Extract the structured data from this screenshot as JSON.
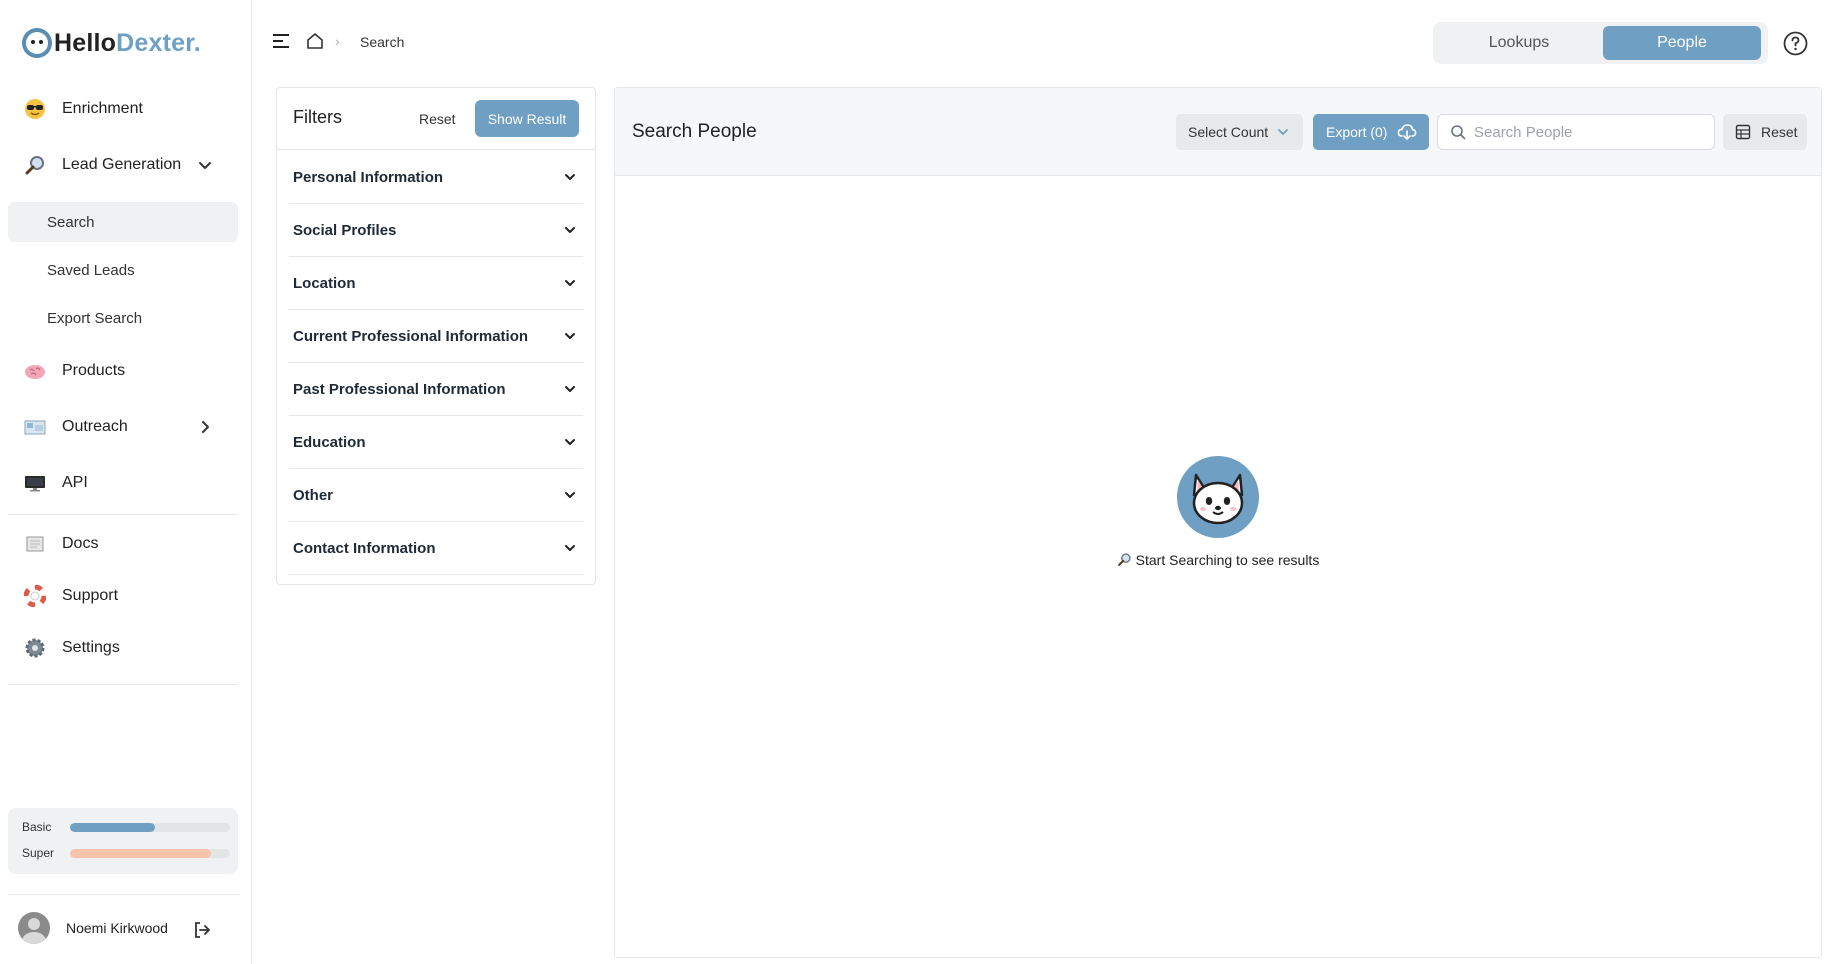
{
  "brand": {
    "hello": "Hello",
    "dexter": "Dexter."
  },
  "sidebar": {
    "items": [
      {
        "label": "Enrichment",
        "icon": "sunglasses-emoji-icon"
      },
      {
        "label": "Lead Generation",
        "icon": "magnifier-emoji-icon"
      },
      {
        "label": "Products",
        "icon": "brain-emoji-icon"
      },
      {
        "label": "Outreach",
        "icon": "map-emoji-icon"
      },
      {
        "label": "API",
        "icon": "monitor-emoji-icon"
      },
      {
        "label": "Docs",
        "icon": "book-emoji-icon"
      },
      {
        "label": "Support",
        "icon": "lifebuoy-emoji-icon"
      },
      {
        "label": "Settings",
        "icon": "gear-emoji-icon"
      }
    ],
    "sub_items": [
      {
        "label": "Search",
        "active": true
      },
      {
        "label": "Saved Leads",
        "active": false
      },
      {
        "label": "Export Search",
        "active": false
      }
    ]
  },
  "credits": {
    "basic": {
      "label": "Basic",
      "fraction": 0.53,
      "color": "#6fa0c4"
    },
    "super": {
      "label": "Super",
      "fraction": 0.88,
      "color": "#f7c3ac"
    }
  },
  "user": {
    "name": "Noemi Kirkwood"
  },
  "breadcrumb": {
    "current": "Search"
  },
  "toggle": {
    "lookups": "Lookups",
    "people": "People",
    "active": "People"
  },
  "filters": {
    "title": "Filters",
    "reset_label": "Reset",
    "show_label": "Show Result",
    "sections": [
      "Personal Information",
      "Social Profiles",
      "Location",
      "Current Professional Information",
      "Past Professional Information",
      "Education",
      "Other",
      "Contact Information"
    ]
  },
  "results": {
    "title": "Search People",
    "select_count_label": "Select Count",
    "export_label": "Export (0)",
    "search_placeholder": "Search People",
    "reset_label": "Reset",
    "empty_message": "Start Searching to see results"
  },
  "colors": {
    "accent": "#6fa0c4",
    "muted_bg": "#f0f1f3"
  }
}
